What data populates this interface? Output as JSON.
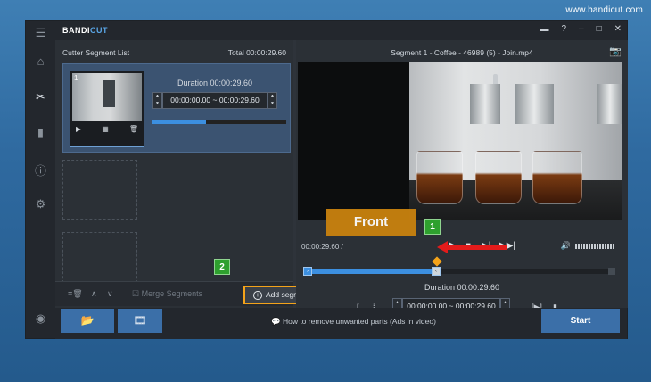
{
  "watermark": "www.bandicut.com",
  "app": {
    "logo_a": "BANDI",
    "logo_b": "CUT"
  },
  "sidebar": {
    "icons": [
      "menu-icon",
      "home-icon",
      "cut-icon",
      "film-icon",
      "info-icon",
      "gear-icon",
      "record-icon"
    ]
  },
  "left": {
    "title": "Cutter Segment List",
    "total": "Total 00:00:29.60",
    "segment": {
      "number": "1",
      "duration": "Duration 00:00:29.60",
      "start": "00:00:00.00",
      "sep": "~",
      "end": "00:00:29.60",
      "progress": 0.4
    },
    "merge": "Merge Segments",
    "add_segment": "Add segment"
  },
  "right": {
    "title": "Segment 1 - Coffee - 46989 (5) - Join.mp4",
    "time_overlay": "00:00:29.60 /",
    "duration": "Duration 00:00:29.60",
    "start": "00:00:00.00",
    "sep": "~",
    "end": "00:00:29.60"
  },
  "bottom": {
    "ads": "How to remove unwanted parts (Ads in video)",
    "start": "Start"
  },
  "callouts": {
    "front": "Front",
    "badge1": "1",
    "badge2": "2"
  },
  "colors": {
    "accent": "#3c8fe0",
    "orange": "#f4a31a",
    "red": "#e31b1b",
    "green": "#2ea02e"
  }
}
